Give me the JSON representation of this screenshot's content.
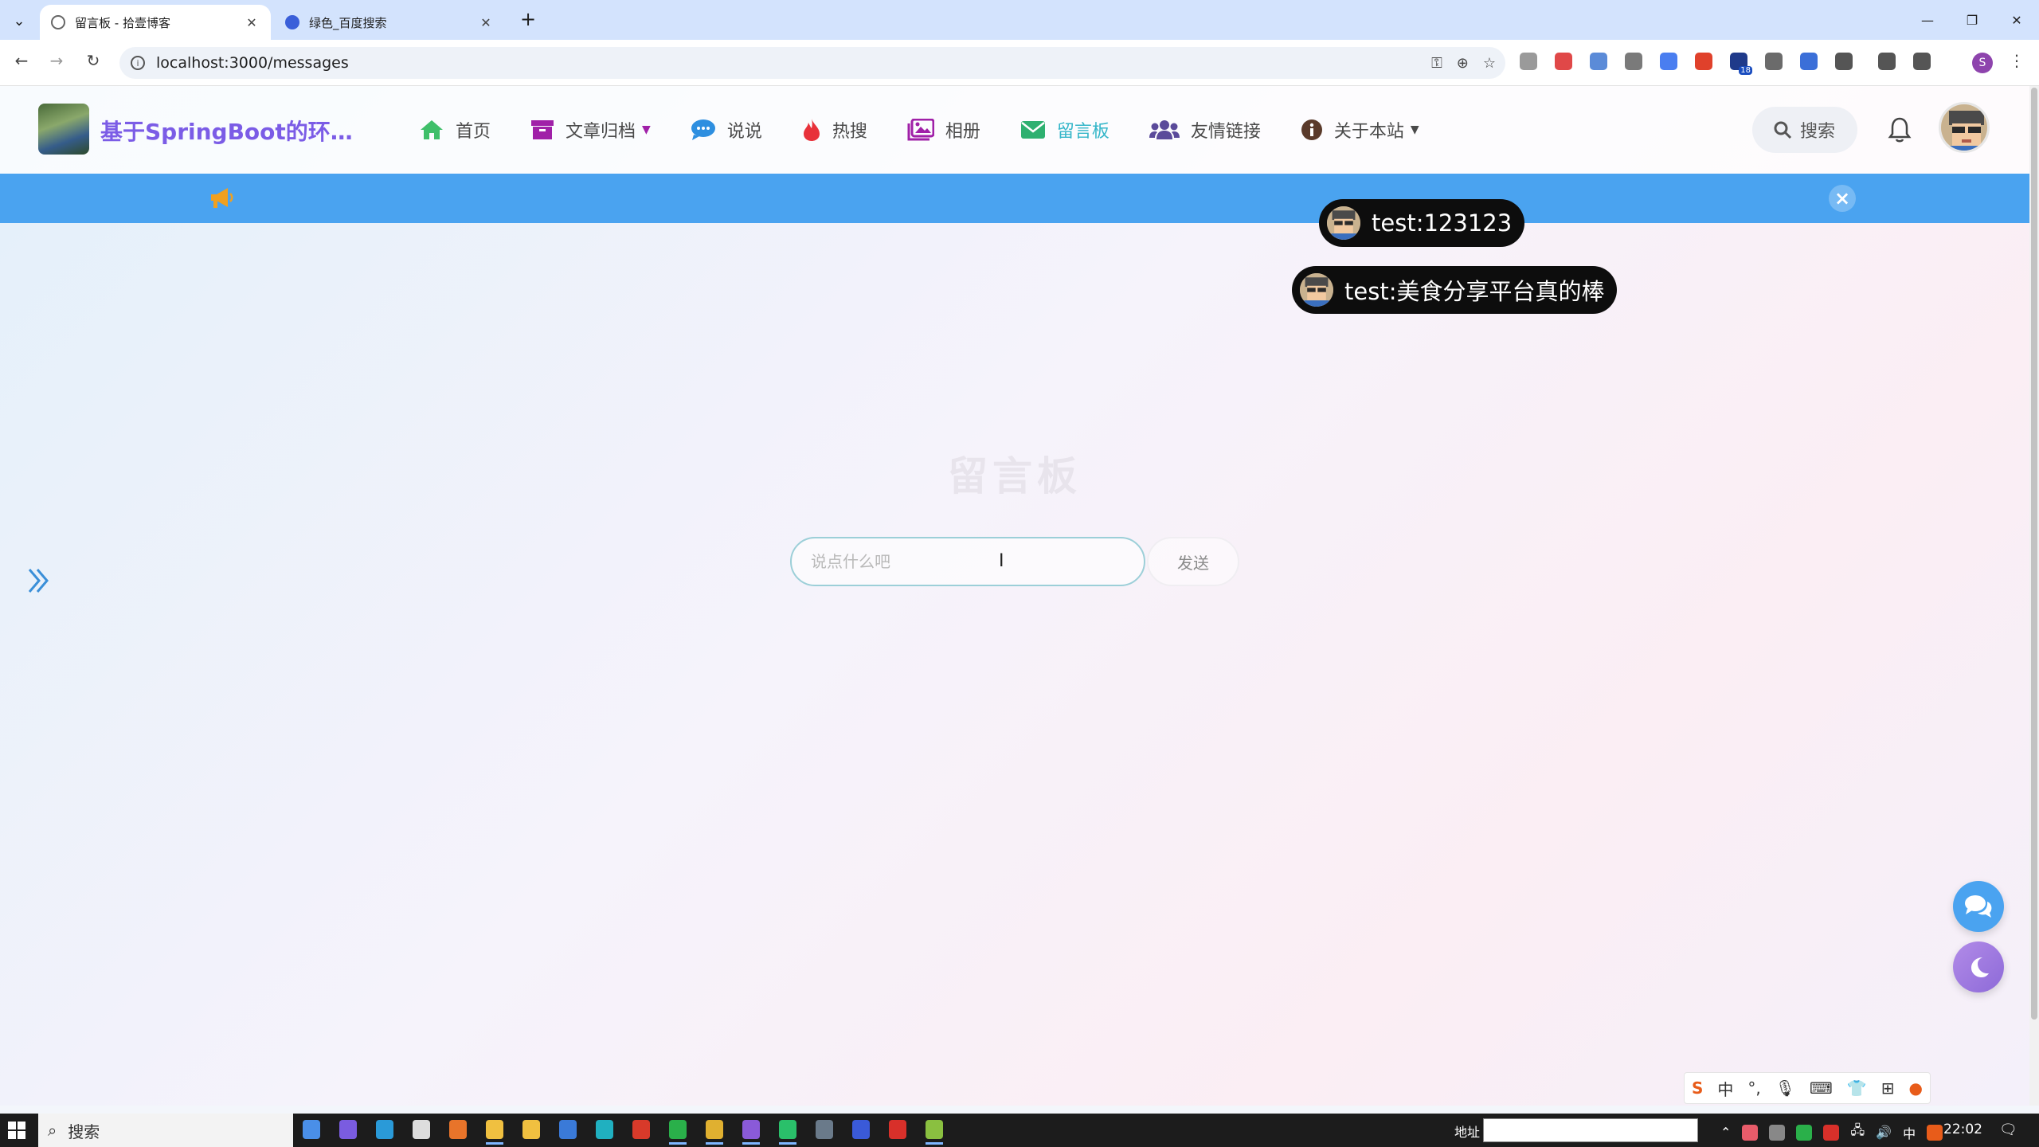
{
  "browser": {
    "tabs": [
      {
        "title": "留言板 - 拾壹博客",
        "active": true
      },
      {
        "title": "绿色_百度搜索",
        "active": false
      }
    ],
    "url": "localhost:3000/messages",
    "profile_initial": "S",
    "extension_badge": "18"
  },
  "site": {
    "title": "基于SpringBoot的环…",
    "menu": [
      {
        "label": "首页",
        "icon": "home-icon",
        "active": false,
        "dropdown": false
      },
      {
        "label": "文章归档",
        "icon": "archive-icon",
        "active": false,
        "dropdown": true
      },
      {
        "label": "说说",
        "icon": "comment-icon",
        "active": false,
        "dropdown": false
      },
      {
        "label": "热搜",
        "icon": "fire-icon",
        "active": false,
        "dropdown": false
      },
      {
        "label": "相册",
        "icon": "images-icon",
        "active": false,
        "dropdown": false
      },
      {
        "label": "留言板",
        "icon": "envelope-icon",
        "active": true,
        "dropdown": false
      },
      {
        "label": "友情链接",
        "icon": "users-icon",
        "active": false,
        "dropdown": false
      },
      {
        "label": "关于本站",
        "icon": "info-icon",
        "active": false,
        "dropdown": true
      }
    ],
    "search_label": "搜索"
  },
  "barrage": [
    {
      "text": "test:123123"
    },
    {
      "text": "test:美食分享平台真的棒"
    }
  ],
  "board": {
    "title": "留言板",
    "input_placeholder": "说点什么吧",
    "send_label": "发送"
  },
  "ime": {
    "lang": "中"
  },
  "taskbar": {
    "search_label": "搜索",
    "address_label": "地址",
    "tray_lang": "中",
    "time": "22:02"
  },
  "colors": {
    "accent": "#35b6c9",
    "notice_bar": "#4aa3f0",
    "title_purple": "#7b5ce6",
    "barrage_bg": "#0d0d0d"
  }
}
